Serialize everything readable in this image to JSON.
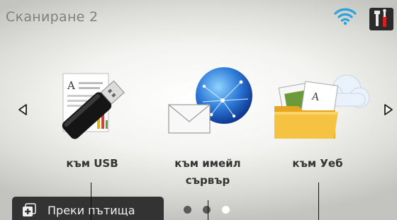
{
  "header": {
    "title": "Сканиране 2",
    "wifi_icon": "wifi-icon",
    "settings_icon": "tools-icon"
  },
  "nav": {
    "prev_icon": "triangle-left-icon",
    "next_icon": "triangle-right-icon"
  },
  "tiles": [
    {
      "label": "към USB",
      "icon": "usb-document-icon"
    },
    {
      "label": "към имейл",
      "label_line2": "сървър",
      "icon": "email-globe-icon"
    },
    {
      "label": "към Уеб",
      "icon": "folder-cloud-icon"
    }
  ],
  "footer": {
    "shortcut_label": "Преки пътища",
    "shortcut_icon": "add-shortcut-icon",
    "pages": {
      "count": 3,
      "current": 3
    }
  },
  "colors": {
    "title": "#808080",
    "wifi": "#29a3d9",
    "footer_bar": "#333333",
    "dot_inactive": "#5a5a5a",
    "dot_active": "#ffffff"
  }
}
